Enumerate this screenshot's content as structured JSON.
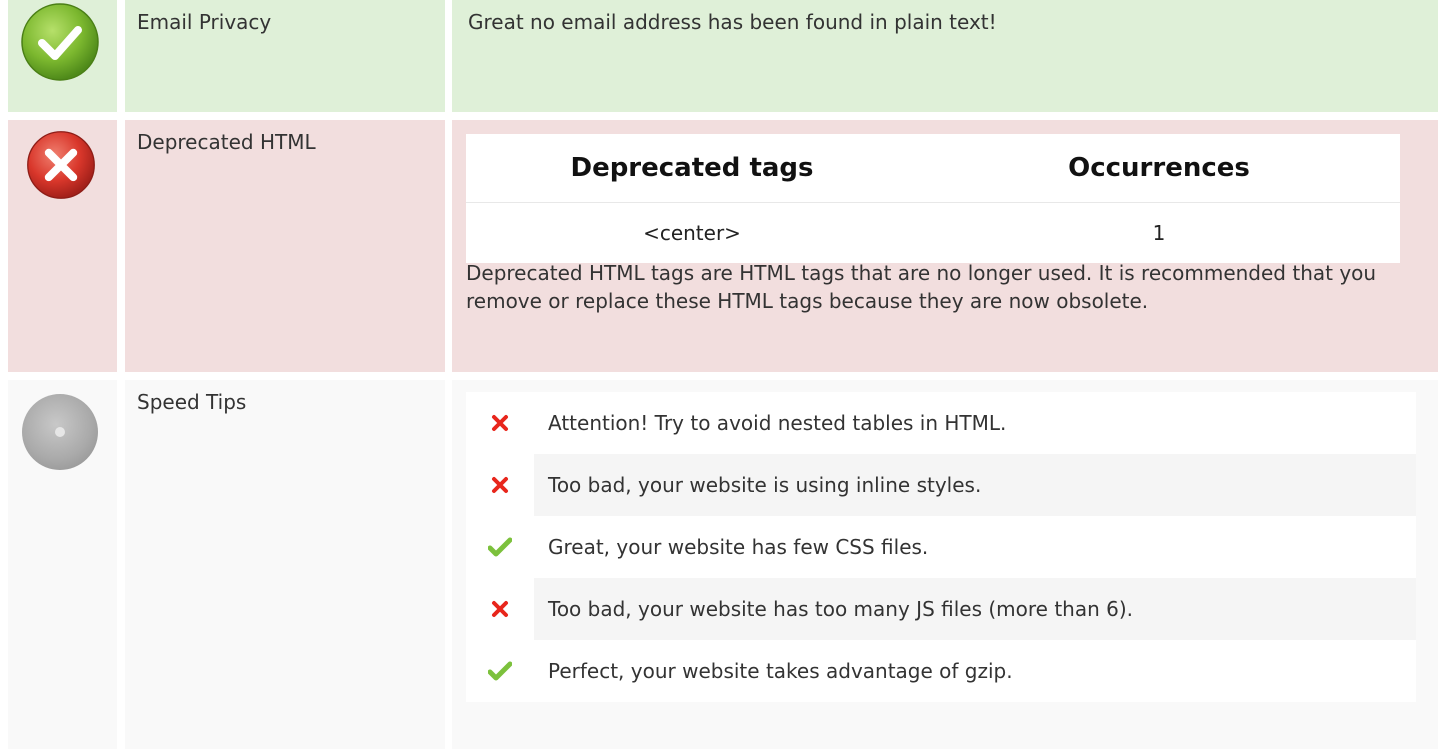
{
  "rows": [
    {
      "status": "success",
      "icon": "check-circle-icon",
      "label": "Email Privacy",
      "text": "Great no email address has been found in plain text!"
    },
    {
      "status": "fail",
      "icon": "x-circle-icon",
      "label": "Deprecated HTML",
      "table": {
        "headers": [
          "Deprecated tags",
          "Occurrences"
        ],
        "rows": [
          [
            "<center>",
            "1"
          ]
        ]
      },
      "text": "Deprecated HTML tags are HTML tags that are no longer used. It is recommended that you remove or replace these HTML tags because they are now obsolete."
    },
    {
      "status": "neutral",
      "icon": "neutral-circle-icon",
      "label": "Speed Tips",
      "tips": [
        {
          "status": "fail",
          "icon": "cross-icon",
          "text": "Attention! Try to avoid nested tables in HTML."
        },
        {
          "status": "fail",
          "icon": "cross-icon",
          "text": "Too bad, your website is using inline styles."
        },
        {
          "status": "pass",
          "icon": "check-icon",
          "text": "Great, your website has few CSS files."
        },
        {
          "status": "fail",
          "icon": "cross-icon",
          "text": "Too bad, your website has too many JS files (more than 6)."
        },
        {
          "status": "pass",
          "icon": "check-icon",
          "text": "Perfect, your website takes advantage of gzip."
        }
      ]
    }
  ],
  "colors": {
    "success_bg": "#dff0d8",
    "fail_bg": "#f2dede",
    "neutral_bg": "#f9f9f9",
    "fail_mark": "#e8261c",
    "pass_mark": "#7cc13c"
  }
}
